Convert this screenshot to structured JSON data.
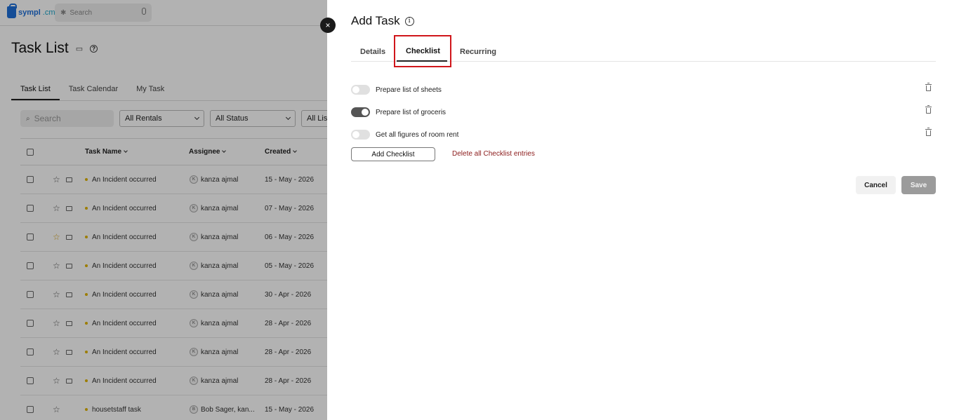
{
  "app": {
    "logo_text": "sympl",
    "logo_suffix": ".cm",
    "search_placeholder": "Search"
  },
  "page": {
    "title": "Task List",
    "tabs": [
      "Task List",
      "Task Calendar",
      "My Task"
    ],
    "filters": {
      "search_placeholder": "Search",
      "rentals": "All Rentals",
      "status": "All Status",
      "lists": "All List"
    },
    "table": {
      "headers": {
        "name": "Task Name",
        "assignee": "Assignee",
        "created": "Created"
      },
      "rows": [
        {
          "name": "An Incident occurred",
          "avatar": "K",
          "assignee": "kanza ajmal",
          "created": "15 - May - 2026",
          "starred": false
        },
        {
          "name": "An Incident occurred",
          "avatar": "K",
          "assignee": "kanza ajmal",
          "created": "07 - May - 2026",
          "starred": false
        },
        {
          "name": "An Incident occurred",
          "avatar": "K",
          "assignee": "kanza ajmal",
          "created": "06 - May - 2026",
          "starred": true
        },
        {
          "name": "An Incident occurred",
          "avatar": "K",
          "assignee": "kanza ajmal",
          "created": "05 - May - 2026",
          "starred": false
        },
        {
          "name": "An Incident occurred",
          "avatar": "K",
          "assignee": "kanza ajmal",
          "created": "30 - Apr - 2026",
          "starred": false
        },
        {
          "name": "An Incident occurred",
          "avatar": "K",
          "assignee": "kanza ajmal",
          "created": "28 - Apr - 2026",
          "starred": false
        },
        {
          "name": "An Incident occurred",
          "avatar": "K",
          "assignee": "kanza ajmal",
          "created": "28 - Apr - 2026",
          "starred": false
        },
        {
          "name": "An Incident occurred",
          "avatar": "K",
          "assignee": "kanza ajmal",
          "created": "28 - Apr - 2026",
          "starred": false
        },
        {
          "name": "housetstaff task",
          "avatar": "B",
          "assignee": "Bob Sager, kan...",
          "created": "15 - May - 2026",
          "starred": false
        }
      ]
    }
  },
  "drawer": {
    "title": "Add Task",
    "close_label": "×",
    "tabs": {
      "details": "Details",
      "checklist": "Checklist",
      "recurring": "Recurring"
    },
    "active_tab": "Checklist",
    "checklist": [
      {
        "label": "Prepare list of sheets",
        "checked": false
      },
      {
        "label": "Prepare list of groceris",
        "checked": true
      },
      {
        "label": "Get all figures of room rent",
        "checked": false
      }
    ],
    "add_checklist_label": "Add Checklist",
    "delete_all_label": "Delete all Checklist entries",
    "cancel_label": "Cancel",
    "save_label": "Save"
  },
  "colors": {
    "highlight": "#d0161b",
    "danger_link": "#8b1a1a",
    "brand": "#1e6fd9",
    "save_disabled": "#9b9b9b"
  }
}
